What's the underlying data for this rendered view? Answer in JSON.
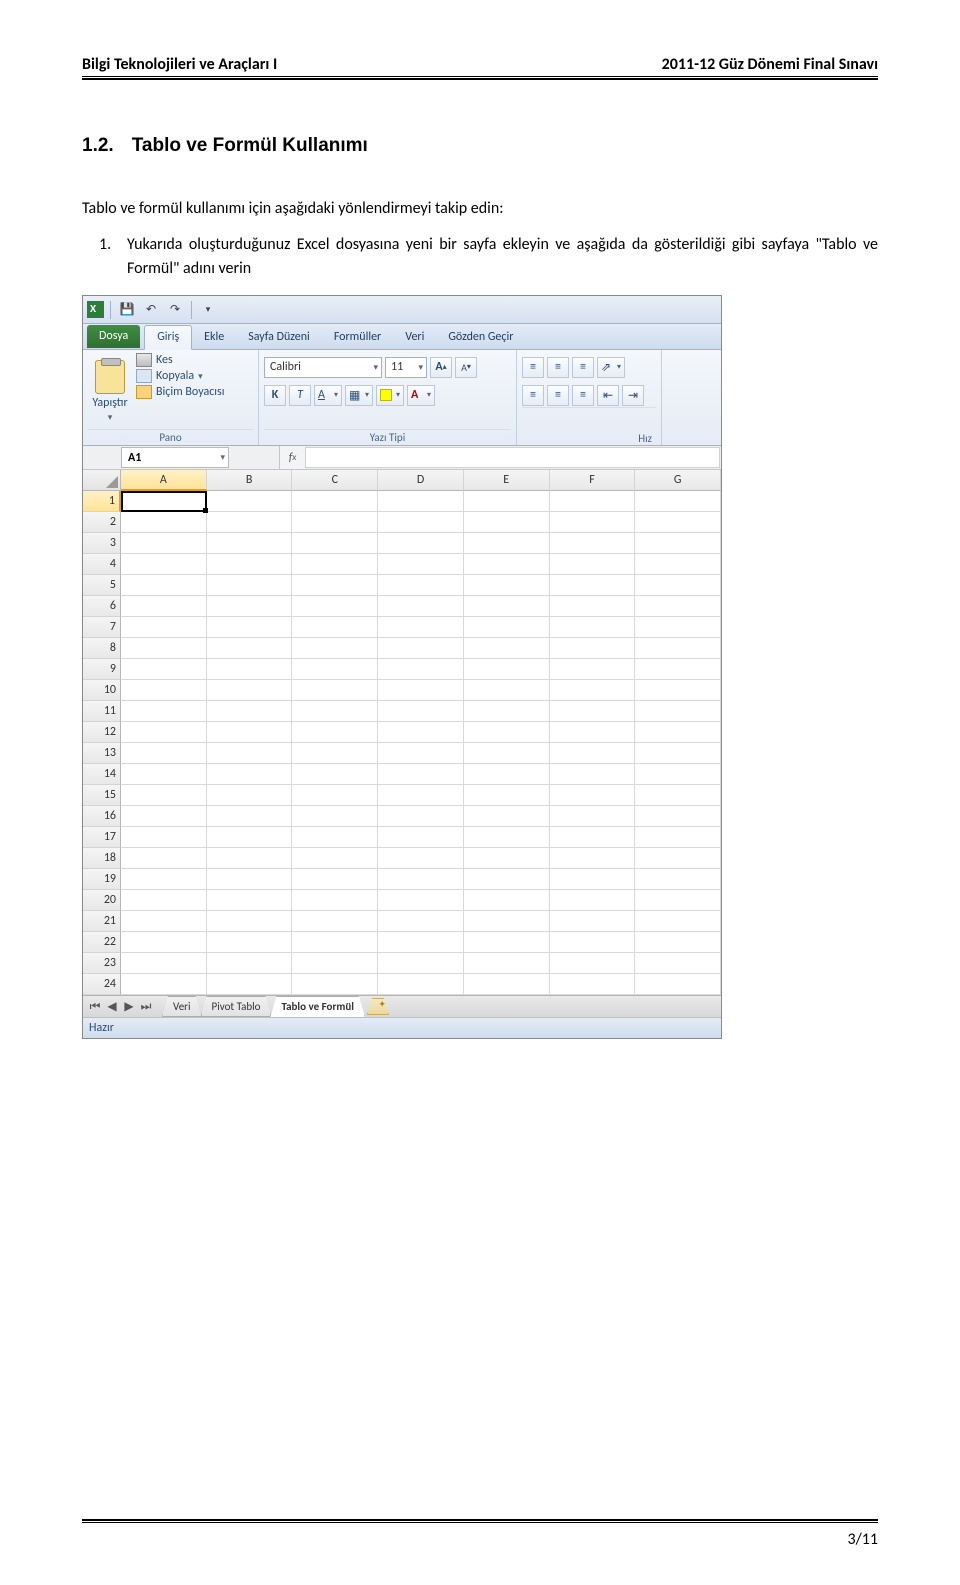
{
  "header": {
    "left": "Bilgi Teknolojileri ve Araçları I",
    "right": "2011-12 Güz Dönemi Final Sınavı"
  },
  "section": {
    "number": "1.2.",
    "title": "Tablo ve Formül Kullanımı"
  },
  "intro": "Tablo ve formül kullanımı için aşağıdaki yönlendirmeyi takip edin:",
  "steps": [
    {
      "n": "1.",
      "text": "Yukarıda oluşturduğunuz Excel dosyasına yeni bir sayfa ekleyin ve aşağıda da gösterildiği gibi sayfaya \"Tablo ve Formül\" adını verin"
    }
  ],
  "excel": {
    "tabs": {
      "file": "Dosya",
      "home": "Giriş",
      "insert": "Ekle",
      "layout": "Sayfa Düzeni",
      "formulas": "Formüller",
      "data": "Veri",
      "review": "Gözden Geçir"
    },
    "clipboard": {
      "paste": "Yapıştır",
      "cut": "Kes",
      "copy": "Kopyala",
      "painter": "Biçim Boyacısı",
      "group": "Pano"
    },
    "font": {
      "name": "Calibri",
      "size": "11",
      "group": "Yazı Tipi"
    },
    "align": {
      "group": "Hız"
    },
    "namebox": "A1",
    "columns": [
      "A",
      "B",
      "C",
      "D",
      "E",
      "F",
      "G"
    ],
    "rows": [
      "1",
      "2",
      "3",
      "4",
      "5",
      "6",
      "7",
      "8",
      "9",
      "10",
      "11",
      "12",
      "13",
      "14",
      "15",
      "16",
      "17",
      "18",
      "19",
      "20",
      "21",
      "22",
      "23",
      "24"
    ],
    "sheets": {
      "s1": "Veri",
      "s2": "Pivot Tablo",
      "s3": "Tablo ve Formül"
    },
    "status": "Hazır"
  },
  "footer": {
    "page": "3/11"
  }
}
